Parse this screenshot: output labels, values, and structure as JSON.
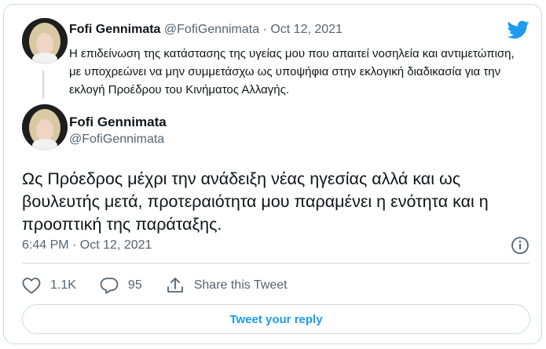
{
  "parent_tweet": {
    "name": "Fofi Gennimata",
    "handle": "@FofiGennimata",
    "separator": "·",
    "date": "Oct 12, 2021",
    "text": "Η επιδείνωση της κατάστασης της υγείας μου που απαιτεί νοσηλεία και αντιμετώπιση, με υποχρεώνει να μην συμμετάσχω ως υποψήφια στην εκλογική διαδικασία για την εκλογή Προέδρου του Κινήματος Αλλαγής."
  },
  "main_tweet": {
    "name": "Fofi Gennimata",
    "handle": "@FofiGennimata",
    "text": "Ως Πρόεδρος μέχρι την ανάδειξη νέας ηγεσίας αλλά και ως βουλευτής μετά, προτεραιότητα μου παραμένει η ενότητα και η προοπτική της παράταξης.",
    "timestamp": "6:44 PM · Oct 12, 2021"
  },
  "actions": {
    "likes": "1.1K",
    "replies": "95",
    "share_label": "Share this Tweet"
  },
  "reply_button_label": "Tweet your reply",
  "colors": {
    "accent": "#1d9bf0",
    "text_primary": "#0f1419",
    "text_secondary": "#536471",
    "border": "#cfd9de"
  },
  "icons": [
    "twitter-bird-icon",
    "info-icon",
    "heart-icon",
    "reply-bubble-icon",
    "share-icon"
  ]
}
